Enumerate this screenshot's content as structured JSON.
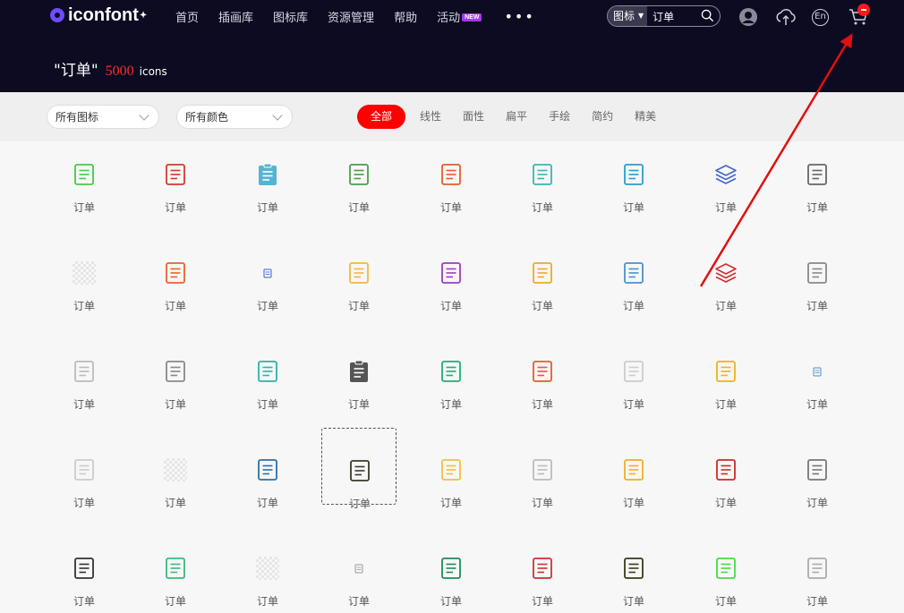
{
  "header": {
    "logo_text": "iconfont",
    "nav": [
      {
        "label": "首页"
      },
      {
        "label": "插画库"
      },
      {
        "label": "图标库"
      },
      {
        "label": "资源管理"
      },
      {
        "label": "帮助"
      },
      {
        "label": "活动",
        "badge": "NEW"
      }
    ],
    "more_label": "•••",
    "search": {
      "type": "图标",
      "query": "订单"
    },
    "icons": [
      "user-avatar-icon",
      "upload-cloud-icon",
      "language-en-icon",
      "cart-icon"
    ],
    "language_label": "En"
  },
  "headline": {
    "query": "\"订单\"",
    "count": "5000",
    "unit": "icons"
  },
  "filters": {
    "icon_type": "所有图标",
    "color": "所有颜色",
    "styles": [
      "全部",
      "线性",
      "面性",
      "扁平",
      "手绘",
      "简约",
      "精美"
    ],
    "active_style": "全部"
  },
  "colors": {
    "brand_red": "#ff0000",
    "header_bg": "#0d0b22"
  },
  "icons": [
    [
      {
        "label": "订单",
        "color": "#44cc44",
        "kind": "doc"
      },
      {
        "label": "订单",
        "color": "#d43a2a",
        "kind": "doc"
      },
      {
        "label": "订单",
        "color": "#56b4d3",
        "kind": "clip"
      },
      {
        "label": "订单",
        "color": "#4a9e4a",
        "kind": "doc"
      },
      {
        "label": "订单",
        "color": "#e85a2a",
        "kind": "doc"
      },
      {
        "label": "订单",
        "color": "#35b8b0",
        "kind": "doc"
      },
      {
        "label": "订单",
        "color": "#2a9cd0",
        "kind": "doc"
      },
      {
        "label": "订单",
        "color": "#4466cc",
        "kind": "stack"
      },
      {
        "label": "订单",
        "color": "#666666",
        "kind": "doc"
      }
    ],
    [
      {
        "label": "订单",
        "color": "#e0e0e0",
        "kind": "checker"
      },
      {
        "label": "订单",
        "color": "#e8632a",
        "kind": "doc"
      },
      {
        "label": "订单",
        "color": "#3366cc",
        "kind": "tiny"
      },
      {
        "label": "订单",
        "color": "#f0b840",
        "kind": "doc"
      },
      {
        "label": "订单",
        "color": "#9b3cc8",
        "kind": "doc"
      },
      {
        "label": "订单",
        "color": "#f5a623",
        "kind": "doc"
      },
      {
        "label": "订单",
        "color": "#4a90d0",
        "kind": "doc"
      },
      {
        "label": "订单",
        "color": "#d03030",
        "kind": "stack"
      },
      {
        "label": "订单",
        "color": "#888888",
        "kind": "doc"
      }
    ],
    [
      {
        "label": "订单",
        "color": "#bbbbbb",
        "kind": "doc"
      },
      {
        "label": "订单",
        "color": "#888888",
        "kind": "doc"
      },
      {
        "label": "订单",
        "color": "#2fb0a8",
        "kind": "doc"
      },
      {
        "label": "订单",
        "color": "#555555",
        "kind": "clip"
      },
      {
        "label": "订单",
        "color": "#22aa77",
        "kind": "doc"
      },
      {
        "label": "订单",
        "color": "#e85a2a",
        "kind": "doc"
      },
      {
        "label": "订单",
        "color": "#cccccc",
        "kind": "doc"
      },
      {
        "label": "订单",
        "color": "#f0b020",
        "kind": "doc"
      },
      {
        "label": "订单",
        "color": "#4a90d0",
        "kind": "tiny"
      }
    ],
    [
      {
        "label": "订单",
        "color": "#cccccc",
        "kind": "doc"
      },
      {
        "label": "订单",
        "color": "#e0e0e0",
        "kind": "checker"
      },
      {
        "label": "订单",
        "color": "#2d6fa8",
        "kind": "doc"
      },
      {
        "label": "订单",
        "color": "#3a3a2a",
        "kind": "doc"
      },
      {
        "label": "订单",
        "color": "#f0c040",
        "kind": "doc"
      },
      {
        "label": "订单",
        "color": "#bbbbbb",
        "kind": "doc"
      },
      {
        "label": "订单",
        "color": "#f0b020",
        "kind": "doc"
      },
      {
        "label": "订单",
        "color": "#d02828",
        "kind": "doc"
      },
      {
        "label": "订单",
        "color": "#777777",
        "kind": "doc"
      }
    ],
    [
      {
        "label": "订单",
        "color": "#333333",
        "kind": "doc"
      },
      {
        "label": "订单",
        "color": "#3cb878",
        "kind": "doc"
      },
      {
        "label": "订单",
        "color": "#e0e0e0",
        "kind": "checker"
      },
      {
        "label": "订单",
        "color": "#999999",
        "kind": "tiny"
      },
      {
        "label": "订单",
        "color": "#1f8a5a",
        "kind": "doc"
      },
      {
        "label": "订单",
        "color": "#d03030",
        "kind": "doc"
      },
      {
        "label": "订单",
        "color": "#3a3a1a",
        "kind": "doc"
      },
      {
        "label": "订单",
        "color": "#44dd44",
        "kind": "doc"
      },
      {
        "label": "订单",
        "color": "#aaaaaa",
        "kind": "doc"
      }
    ]
  ],
  "selected_cell": [
    3,
    3
  ]
}
